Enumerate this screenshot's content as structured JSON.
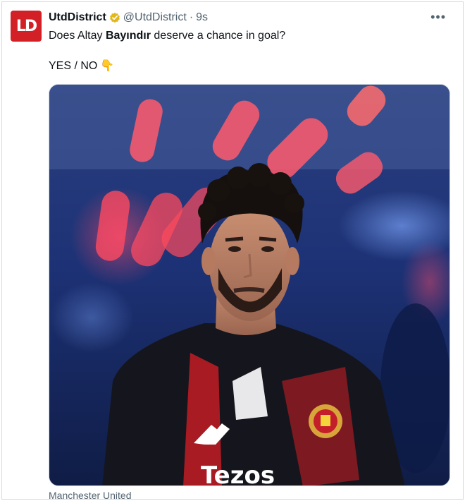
{
  "account": {
    "avatar_text": "LD",
    "name": "UtdDistrict",
    "handle": "@UtdDistrict",
    "separator": "·",
    "time": "9s",
    "verified_icon": "gold-verified-badge-icon",
    "avatar_color": "#d31f26"
  },
  "tweet": {
    "text_before": "Does Altay ",
    "text_bold": "Bayındır",
    "text_after": " deserve a chance in goal?",
    "poll_text": "YES / NO",
    "poll_emoji": "👇"
  },
  "media": {
    "description_icon": "photo-player-tunnel",
    "sponsor_text": "Tezos"
  },
  "caption": "Manchester United",
  "menu_icon": "more-dots-icon"
}
